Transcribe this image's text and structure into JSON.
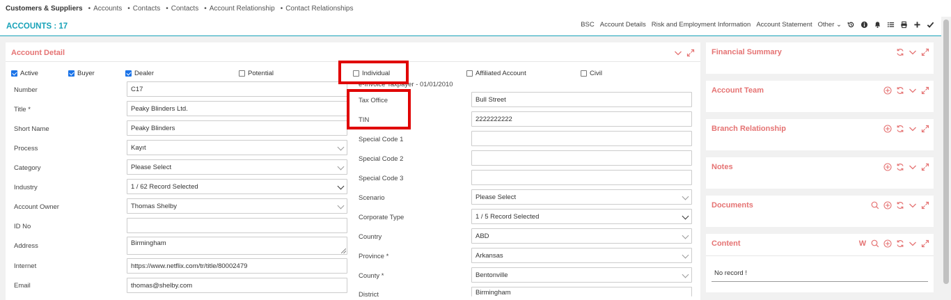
{
  "breadcrumb": {
    "main": "Customers & Suppliers",
    "items": [
      "Accounts",
      "Contacts",
      "Contacts",
      "Account Relationship",
      "Contact Relationships"
    ]
  },
  "header": {
    "title": "ACCOUNTS : 17",
    "nav": [
      "BSC",
      "Account Details",
      "Risk and Employment Information",
      "Account Statement",
      "Other"
    ],
    "icons": [
      "history-icon",
      "info-icon",
      "bell-icon",
      "list-icon",
      "print-icon",
      "plus-icon",
      "check-icon"
    ]
  },
  "detail": {
    "title": "Account Detail",
    "checkboxes": [
      {
        "label": "Active",
        "checked": true
      },
      {
        "label": "Buyer",
        "checked": true
      },
      {
        "label": "Dealer",
        "checked": true
      },
      {
        "label": "Potential",
        "checked": false
      },
      {
        "label": "Individual",
        "checked": false
      },
      {
        "label": "Affiliated Account",
        "checked": false
      },
      {
        "label": "Civil",
        "checked": false
      }
    ],
    "left_fields": [
      {
        "label": "Number",
        "value": "C17"
      },
      {
        "label": "Title *",
        "value": "Peaky Blinders Ltd."
      },
      {
        "label": "Short Name",
        "value": "Peaky Blinders"
      },
      {
        "label": "Process",
        "value": "Kayıt"
      },
      {
        "label": "Category",
        "value": "Please Select"
      },
      {
        "label": "Industry",
        "value": "1 / 62 Record Selected"
      },
      {
        "label": "Account Owner",
        "value": "Thomas Shelby"
      },
      {
        "label": "ID No",
        "value": ""
      },
      {
        "label": "Address",
        "value": "Birmingham"
      },
      {
        "label": "Internet",
        "value": "https://www.netflix.com/tr/title/80002479"
      },
      {
        "label": "Email",
        "value": "thomas@shelby.com"
      }
    ],
    "einvoice_note": "e-Invoice Taxpayer - 01/01/2010",
    "right_fields": [
      {
        "label": "Tax Office",
        "value": "Bull Street"
      },
      {
        "label": "TIN",
        "value": "2222222222"
      },
      {
        "label": "Special Code 1",
        "value": ""
      },
      {
        "label": "Special Code 2",
        "value": ""
      },
      {
        "label": "Special Code 3",
        "value": ""
      },
      {
        "label": "Scenario",
        "value": "Please Select"
      },
      {
        "label": "Corporate Type",
        "value": "1 / 5 Record Selected"
      },
      {
        "label": "Country",
        "value": "ABD"
      },
      {
        "label": "Province *",
        "value": "Arkansas"
      },
      {
        "label": "County *",
        "value": "Bentonville"
      },
      {
        "label": "District",
        "value": "Birmingham"
      }
    ]
  },
  "side_panels": [
    {
      "title": "Financial Summary"
    },
    {
      "title": "Account Team"
    },
    {
      "title": "Branch Relationship"
    },
    {
      "title": "Notes"
    },
    {
      "title": "Documents"
    },
    {
      "title": "Content",
      "w_label": "W",
      "empty_text": "No record !"
    }
  ],
  "colors": {
    "accent": "#17a2b8",
    "panel_title": "#e57373",
    "highlight": "#e00000",
    "checkbox": "#1a73e8"
  }
}
